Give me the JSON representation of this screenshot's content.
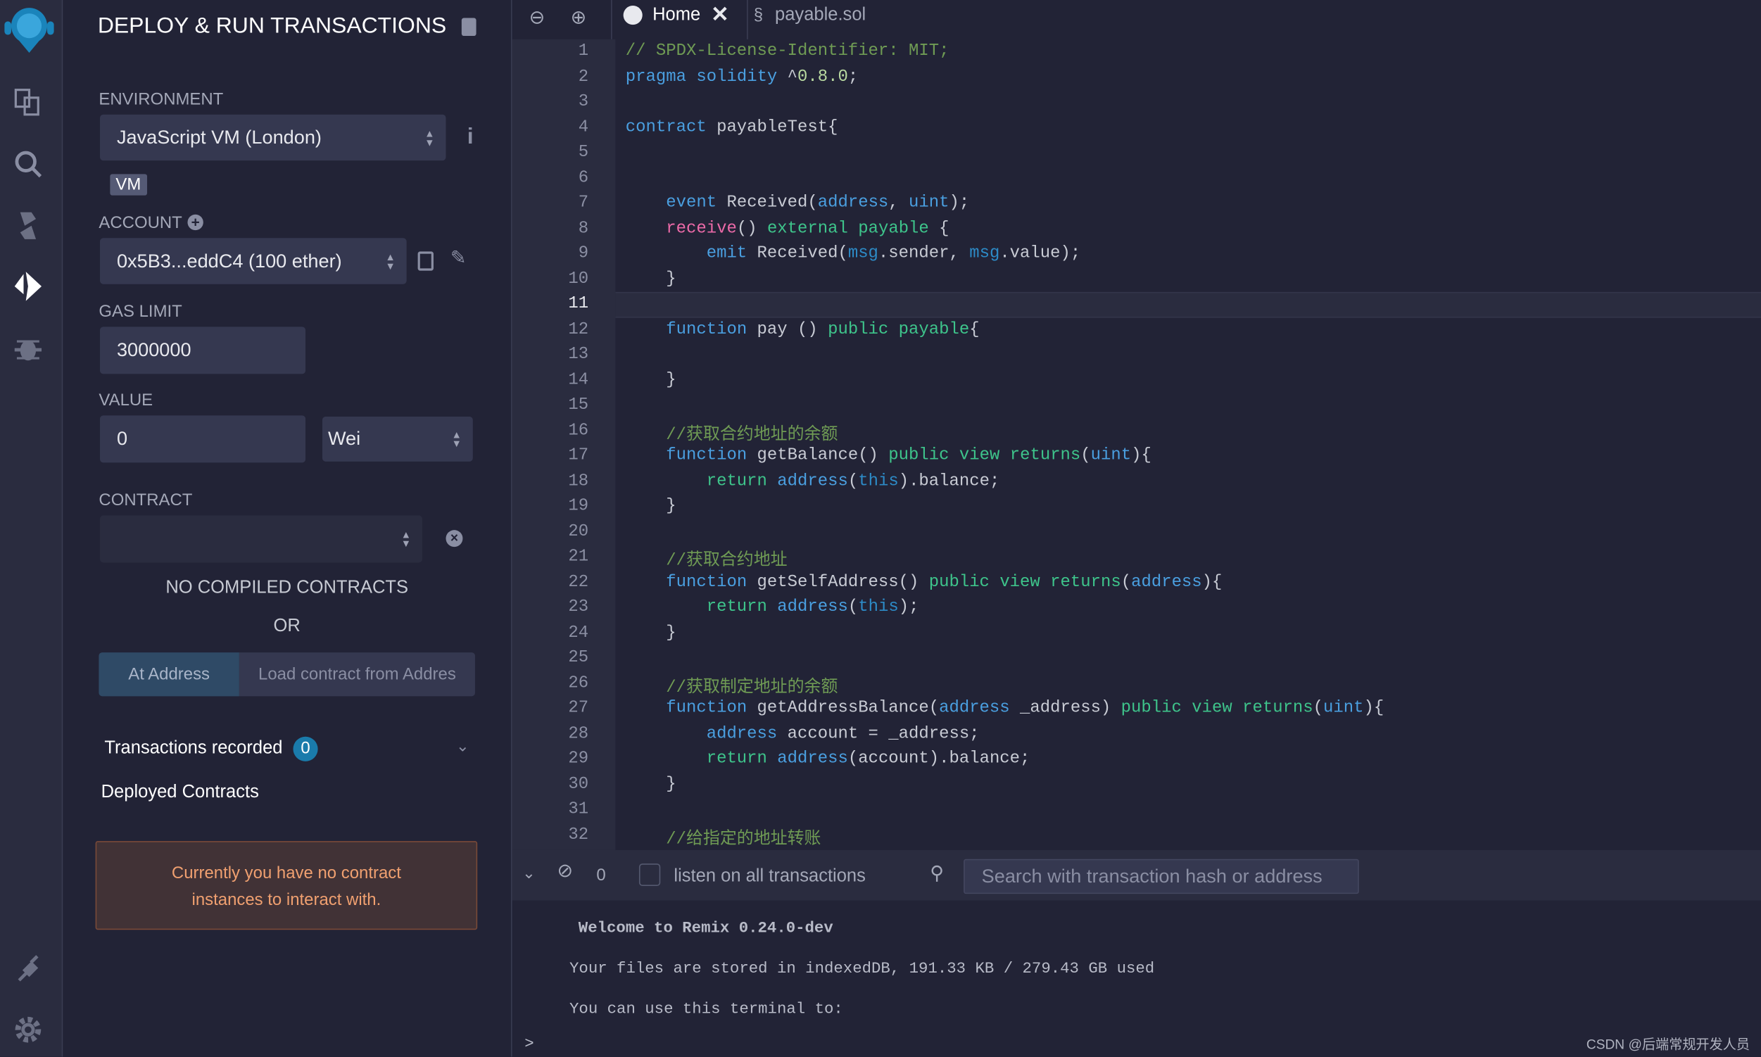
{
  "iconbar": {
    "items": [
      "remix-logo-icon",
      "file-explorer-icon",
      "search-icon",
      "solidity-compiler-icon",
      "deploy-run-icon",
      "debugger-icon"
    ],
    "bottom": [
      "plugin-manager-icon",
      "settings-icon"
    ]
  },
  "panel": {
    "title": "DEPLOY & RUN TRANSACTIONS",
    "environment_label": "ENVIRONMENT",
    "environment_value": "JavaScript VM (London)",
    "vm_badge": "VM",
    "account_label": "ACCOUNT",
    "account_value": "0x5B3...eddC4 (100 ether)",
    "gas_label": "GAS LIMIT",
    "gas_value": "3000000",
    "value_label": "VALUE",
    "value_value": "0",
    "unit_value": "Wei",
    "contract_label": "CONTRACT",
    "contract_value": "",
    "no_compiled": "NO COMPILED CONTRACTS",
    "or": "OR",
    "at_address": "At Address",
    "load_placeholder": "Load contract from Addres",
    "tx_recorded": "Transactions recorded",
    "tx_count": "0",
    "deployed": "Deployed Contracts",
    "no_instances": "Currently you have no contract instances to interact with."
  },
  "tabs": [
    {
      "label": "Home",
      "icon": "remix-logo-icon",
      "active": true
    },
    {
      "label": "payable.sol",
      "icon": "solidity-icon",
      "active": false
    }
  ],
  "code": [
    [
      [
        "// SPDX-License-Identifier: MIT;",
        "cm"
      ]
    ],
    [
      [
        "pragma",
        "kw"
      ],
      [
        " "
      ],
      [
        "solidity",
        "kw"
      ],
      [
        " ^"
      ],
      [
        "0.8.0",
        "num"
      ],
      [
        ";"
      ]
    ],
    [],
    [
      [
        "contract",
        "kw"
      ],
      [
        " payableTest{"
      ]
    ],
    [],
    [],
    [
      [
        "    "
      ],
      [
        "event",
        "kw"
      ],
      [
        " Received("
      ],
      [
        "address",
        "kw"
      ],
      [
        ", "
      ],
      [
        "uint",
        "kw"
      ],
      [
        ");"
      ]
    ],
    [
      [
        "    "
      ],
      [
        "receive",
        "fn"
      ],
      [
        "() "
      ],
      [
        "external",
        "mod"
      ],
      [
        " "
      ],
      [
        "payable",
        "mod"
      ],
      [
        " {"
      ]
    ],
    [
      [
        "        "
      ],
      [
        "emit",
        "kw"
      ],
      [
        " Received("
      ],
      [
        "msg",
        "var"
      ],
      [
        ".sender, "
      ],
      [
        "msg",
        "var"
      ],
      [
        ".value);"
      ]
    ],
    [
      [
        "    }"
      ]
    ],
    [],
    [
      [
        "    "
      ],
      [
        "function",
        "kw"
      ],
      [
        " pay () "
      ],
      [
        "public",
        "mod"
      ],
      [
        " "
      ],
      [
        "payable",
        "mod"
      ],
      [
        "{"
      ]
    ],
    [],
    [
      [
        "    }"
      ]
    ],
    [],
    [
      [
        "    "
      ],
      [
        "//获取合约地址的余额",
        "cm"
      ]
    ],
    [
      [
        "    "
      ],
      [
        "function",
        "kw"
      ],
      [
        " getBalance() "
      ],
      [
        "public",
        "mod"
      ],
      [
        " "
      ],
      [
        "view",
        "mod"
      ],
      [
        " "
      ],
      [
        "returns",
        "mod"
      ],
      [
        "("
      ],
      [
        "uint",
        "kw"
      ],
      [
        "){"
      ]
    ],
    [
      [
        "        "
      ],
      [
        "return",
        "mod"
      ],
      [
        " "
      ],
      [
        "address",
        "kw"
      ],
      [
        "("
      ],
      [
        "this",
        "var"
      ],
      [
        ").balance;"
      ]
    ],
    [
      [
        "    }"
      ]
    ],
    [],
    [
      [
        "    "
      ],
      [
        "//获取合约地址",
        "cm"
      ]
    ],
    [
      [
        "    "
      ],
      [
        "function",
        "kw"
      ],
      [
        " getSelfAddress() "
      ],
      [
        "public",
        "mod"
      ],
      [
        " "
      ],
      [
        "view",
        "mod"
      ],
      [
        " "
      ],
      [
        "returns",
        "mod"
      ],
      [
        "("
      ],
      [
        "address",
        "kw"
      ],
      [
        "){"
      ]
    ],
    [
      [
        "        "
      ],
      [
        "return",
        "mod"
      ],
      [
        " "
      ],
      [
        "address",
        "kw"
      ],
      [
        "("
      ],
      [
        "this",
        "var"
      ],
      [
        ");"
      ]
    ],
    [
      [
        "    }"
      ]
    ],
    [],
    [
      [
        "    "
      ],
      [
        "//获取制定地址的余额",
        "cm"
      ]
    ],
    [
      [
        "    "
      ],
      [
        "function",
        "kw"
      ],
      [
        " getAddressBalance("
      ],
      [
        "address",
        "kw"
      ],
      [
        " _address) "
      ],
      [
        "public",
        "mod"
      ],
      [
        " "
      ],
      [
        "view",
        "mod"
      ],
      [
        " "
      ],
      [
        "returns",
        "mod"
      ],
      [
        "("
      ],
      [
        "uint",
        "kw"
      ],
      [
        "){"
      ]
    ],
    [
      [
        "        "
      ],
      [
        "address",
        "kw"
      ],
      [
        " account = _address;"
      ]
    ],
    [
      [
        "        "
      ],
      [
        "return",
        "mod"
      ],
      [
        " "
      ],
      [
        "address",
        "kw"
      ],
      [
        "(account).balance;"
      ]
    ],
    [
      [
        "    }"
      ]
    ],
    [],
    [
      [
        "    "
      ],
      [
        "//给指定的地址转账",
        "cm"
      ]
    ]
  ],
  "active_line": 11,
  "terminal": {
    "count": "0",
    "listen_label": "listen on all transactions",
    "search_placeholder": "Search with transaction hash or address",
    "lines": [
      "Welcome to Remix 0.24.0-dev",
      "Your files are stored in indexedDB, 191.33 KB / 279.43 GB used",
      "You can use this terminal to:"
    ],
    "prompt": ">"
  },
  "watermark": "CSDN @后端常规开发人员"
}
